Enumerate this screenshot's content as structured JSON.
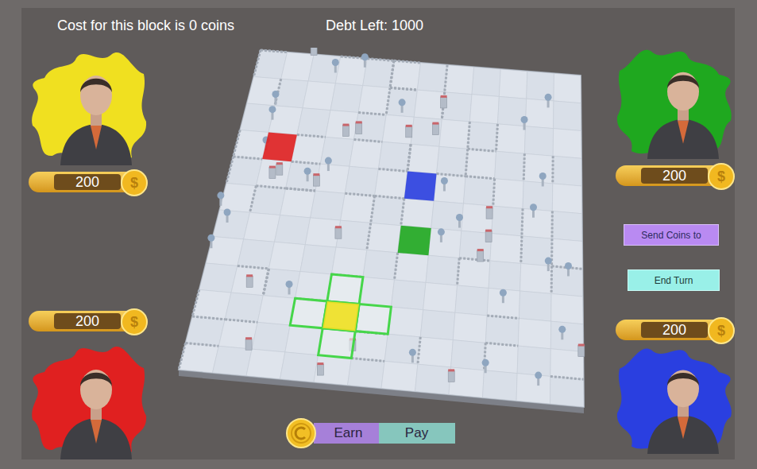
{
  "header": {
    "cost_text": "Cost for this block is 0 coins",
    "debt_text": "Debt Left: 1000"
  },
  "coin_symbol": "$",
  "players": [
    {
      "color": "#f0e020",
      "coins": "200",
      "active": true
    },
    {
      "color": "#e02020",
      "coins": "200",
      "active": false
    },
    {
      "color": "#1fa81f",
      "coins": "200",
      "active": false
    },
    {
      "color": "#2a3fe0",
      "coins": "200",
      "active": false
    }
  ],
  "buttons": {
    "send_coins": "Send Coins to",
    "end_turn": "End Turn"
  },
  "toggle": [
    {
      "label": "Earn",
      "color": "#a680d9"
    },
    {
      "label": "Pay",
      "color": "#86c6bd"
    }
  ]
}
